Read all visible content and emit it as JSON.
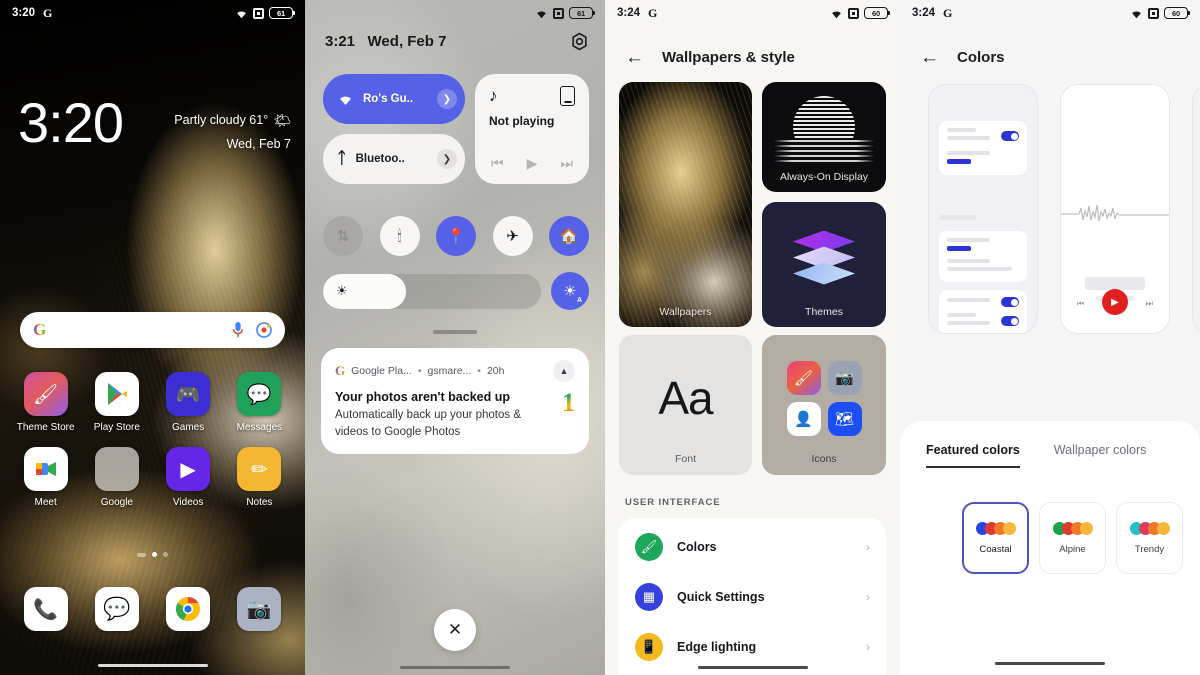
{
  "panel1": {
    "name": "lock-home-screen",
    "status": {
      "time": "3:20",
      "assistant": "G",
      "battery": "61"
    },
    "clock": "3:20",
    "weather": {
      "condition": "Partly cloudy 61°",
      "date": "Wed, Feb 7",
      "icon": "partly-cloudy-icon"
    },
    "search": {
      "placeholder": "",
      "logo": "G",
      "mic": "mic-icon",
      "lens": "lens-icon"
    },
    "apps": [
      {
        "label": "Theme Store",
        "icon": "paint-roller-icon",
        "color": "#e0527f"
      },
      {
        "label": "Play Store",
        "icon": "play-store-icon",
        "color": "#ffffff"
      },
      {
        "label": "Games",
        "icon": "gamepad-icon",
        "color": "#3b2fd4"
      },
      {
        "label": "Messages",
        "icon": "chat-bubble-icon",
        "color": "#1fa15a"
      },
      {
        "label": "Meet",
        "icon": "video-camera-icon",
        "color": "#ffffff"
      },
      {
        "label": "Google",
        "icon": "google-folder-icon",
        "color": "#b9b6ae"
      },
      {
        "label": "Videos",
        "icon": "play-triangle-icon",
        "color": "#6526e8"
      },
      {
        "label": "Notes",
        "icon": "notes-pencil-icon",
        "color": "#f5b731"
      }
    ],
    "dock": [
      {
        "label": "Phone",
        "icon": "phone-icon",
        "color": "#ffffff"
      },
      {
        "label": "Messages",
        "icon": "message-bubble-icon",
        "color": "#ffffff"
      },
      {
        "label": "Chrome",
        "icon": "chrome-icon",
        "color": "#ffffff"
      },
      {
        "label": "Camera",
        "icon": "camera-icon",
        "color": "#aab2c4"
      }
    ],
    "page_dots": 3,
    "active_dot": 1
  },
  "panel2": {
    "name": "quick-settings-shade",
    "status": {
      "battery": "61"
    },
    "header": {
      "time": "3:21",
      "date": "Wed, Feb 7",
      "settings_icon": "gear-icon"
    },
    "wifi_tile": {
      "label": "Ro's Gu..",
      "icon": "wifi-icon",
      "state": "on"
    },
    "bluetooth_tile": {
      "label": "Bluetoo..",
      "icon": "bluetooth-icon",
      "state": "off"
    },
    "media": {
      "status": "Not playing",
      "note_icon": "music-note-icon",
      "cast_icon": "cast-to-device-icon",
      "prev": "skip-previous-icon",
      "play": "play-icon",
      "next": "skip-next-icon"
    },
    "toggles": [
      {
        "name": "data-saver-toggle",
        "icon": "data-transfer-icon",
        "state": "disabled"
      },
      {
        "name": "flashlight-toggle",
        "icon": "flashlight-icon",
        "state": "off"
      },
      {
        "name": "location-toggle",
        "icon": "location-pin-icon",
        "state": "on"
      },
      {
        "name": "airplane-mode-toggle",
        "icon": "airplane-icon",
        "state": "off"
      },
      {
        "name": "smart-home-toggle",
        "icon": "home-icon",
        "state": "on"
      }
    ],
    "brightness": {
      "icon": "brightness-icon",
      "value_percent": 38,
      "auto_icon": "auto-brightness-icon"
    },
    "notification": {
      "app": "Google Pla...",
      "source": "gsmare...",
      "age": "20h",
      "separator": "•",
      "title": "Your photos aren't backed up",
      "body": "Automatically back up your photos & videos to Google Photos",
      "badge": "1",
      "collapse_icon": "chevron-up-icon"
    },
    "close_button": {
      "icon": "close-icon",
      "label": "✕"
    }
  },
  "panel3": {
    "name": "wallpapers-and-style-screen",
    "status": {
      "time": "3:24",
      "assistant": "G",
      "battery": "60"
    },
    "back_icon": "back-arrow-icon",
    "title": "Wallpapers & style",
    "tiles": [
      {
        "label": "Wallpapers",
        "name": "wallpapers-tile"
      },
      {
        "label": "Always-On Display",
        "name": "always-on-display-tile"
      },
      {
        "label": "Themes",
        "name": "themes-tile"
      },
      {
        "label": "Font",
        "name": "font-tile",
        "sample": "Aa"
      },
      {
        "label": "Icons",
        "name": "icons-tile"
      }
    ],
    "icons_preview": [
      {
        "name": "theme-store-mini-icon",
        "color": "#e0527f"
      },
      {
        "name": "camera-mini-icon",
        "color": "#9aa3b4"
      },
      {
        "name": "contacts-mini-icon",
        "color": "#ffffff"
      },
      {
        "name": "gallery-mini-icon",
        "color": "#1b4ef5"
      }
    ],
    "section_label": "USER INTERFACE",
    "list": [
      {
        "label": "Colors",
        "icon": "paint-roller-icon",
        "color": "#1ca75a",
        "chevron": "›"
      },
      {
        "label": "Quick Settings",
        "icon": "quick-settings-icon",
        "color": "#3642e0",
        "chevron": "›"
      },
      {
        "label": "Edge lighting",
        "icon": "edge-lighting-icon",
        "color": "#f5b91e",
        "chevron": "›"
      }
    ]
  },
  "panel4": {
    "name": "colors-screen",
    "status": {
      "time": "3:24",
      "assistant": "G",
      "battery": "60"
    },
    "back_icon": "back-arrow-icon",
    "title": "Colors",
    "previews": [
      {
        "name": "settings-preview-card",
        "accent": "#2b34d6"
      },
      {
        "name": "recorder-preview-card",
        "accent": "#e02020"
      },
      {
        "name": "third-preview-card",
        "accent": "#b9c3cb"
      }
    ],
    "tabs": [
      {
        "label": "Featured colors",
        "active": true
      },
      {
        "label": "Wallpaper colors",
        "active": false
      }
    ],
    "swatches": [
      {
        "label": "Coastal",
        "selected": true,
        "colors": [
          "#2b44e0",
          "#e03b2a",
          "#f0762a",
          "#f7b83a"
        ]
      },
      {
        "label": "Alpine",
        "selected": false,
        "colors": [
          "#19a34c",
          "#e03b2a",
          "#f0762a",
          "#f7b83a"
        ]
      },
      {
        "label": "Trendy",
        "selected": false,
        "colors": [
          "#1ec2c8",
          "#e03b5a",
          "#f0762a",
          "#f7b83a"
        ]
      }
    ]
  }
}
